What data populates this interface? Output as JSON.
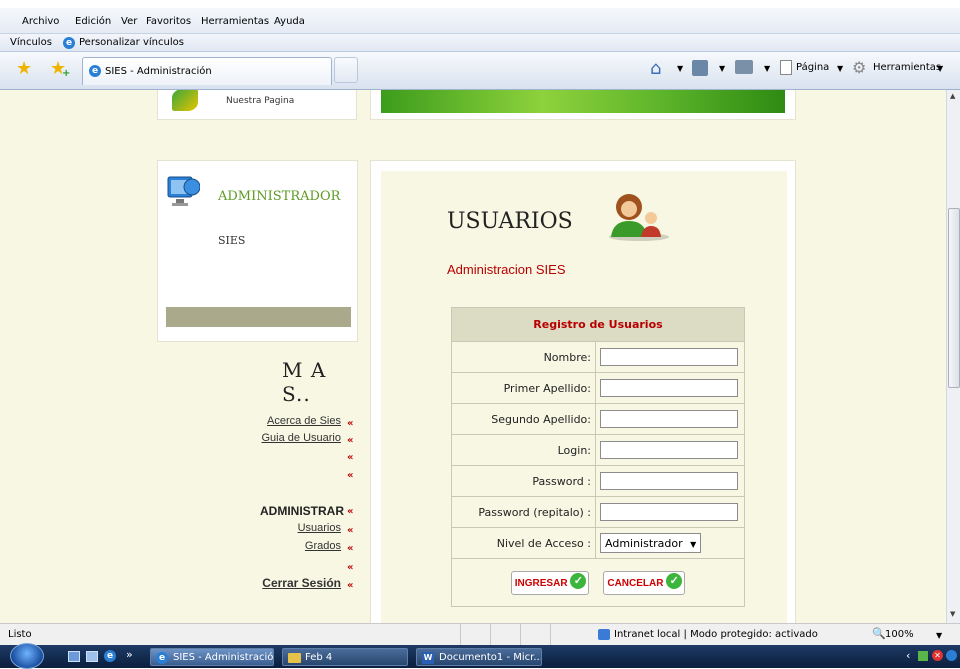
{
  "menubar": {
    "items": [
      "Archivo",
      "Edición",
      "Ver",
      "Favoritos",
      "Herramientas",
      "Ayuda"
    ]
  },
  "linksbar": {
    "label": "Vínculos",
    "custom": "Personalizar vínculos"
  },
  "tab": {
    "title": "SIES - Administración"
  },
  "toolbar": {
    "page": "Página",
    "tools": "Herramientas"
  },
  "top_panel": {
    "label": "Nuestra Pagina"
  },
  "admin_box": {
    "title": "ADMINISTRADOR",
    "subtitle": "SIES"
  },
  "sidebar": {
    "heading": "M A S..",
    "links": [
      "Acerca de Sies",
      "Guia de Usuario"
    ],
    "section": "ADMINISTRAR",
    "admin_links": [
      "Usuarios",
      "Grados"
    ],
    "logout": "Cerrar Sesión",
    "marker": "«"
  },
  "main": {
    "title": "USUARIOS",
    "subtitle": "Administracion SIES"
  },
  "form": {
    "header": "Registro de Usuarios",
    "labels": [
      "Nombre:",
      "Primer Apellido:",
      "Segundo Apellido:",
      "Login:",
      "Password :",
      "Password (repitalo) :",
      "Nivel de Acceso :"
    ],
    "access_level": "Administrador",
    "submit": "INGRESAR",
    "cancel": "CANCELAR"
  },
  "status": {
    "text": "Listo",
    "zone": "Intranet local | Modo protegido: activado",
    "zoom": "100%"
  },
  "taskbar": {
    "items": [
      "SIES - Administració...",
      "Feb 4",
      "Documento1 - Micr..."
    ]
  },
  "colors": {
    "page_bg": "#f7f7e4",
    "accent_red": "#b80000",
    "admin_green": "#5e9b24",
    "form_header_bg": "#dcdcc5"
  }
}
